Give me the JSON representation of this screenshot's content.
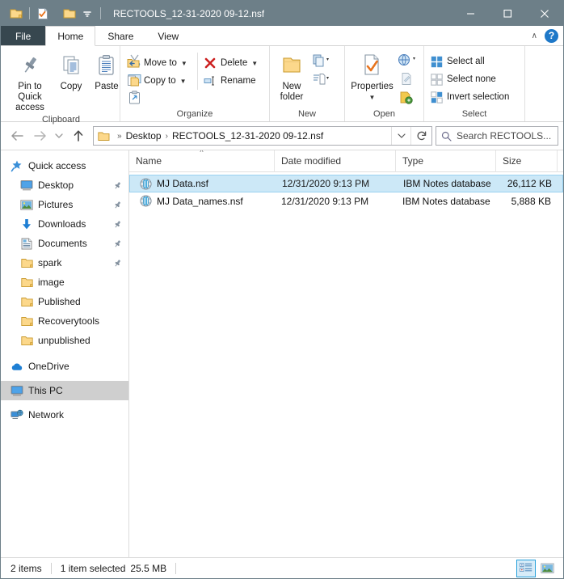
{
  "window": {
    "title": "RECTOOLS_12-31-2020 09-12.nsf",
    "titlebar_color": "#6d7f88",
    "quick_access": [
      {
        "name": "folder-icon",
        "label": "Restore/Folder"
      },
      {
        "name": "properties-icon",
        "label": "Properties"
      },
      {
        "name": "new-folder-icon",
        "label": "New folder"
      },
      {
        "name": "chevron-down-icon",
        "label": "Customize Quick Access Toolbar"
      }
    ],
    "controls": {
      "minimize": "—",
      "maximize": "☐",
      "close": "✕"
    }
  },
  "tabs": [
    {
      "label": "File",
      "active": false,
      "kind": "file"
    },
    {
      "label": "Home",
      "active": true,
      "kind": "normal"
    },
    {
      "label": "Share",
      "active": false,
      "kind": "normal"
    },
    {
      "label": "View",
      "active": false,
      "kind": "normal"
    }
  ],
  "tabbar_right": {
    "collapse_label": "∧",
    "help_label": "?"
  },
  "ribbon": {
    "groups": [
      {
        "label": "Clipboard",
        "big_buttons": [
          {
            "name": "pin-to-quick-access-button",
            "label": "Pin to Quick\naccess",
            "line1": "Pin to Quick",
            "line2": "access"
          },
          {
            "name": "copy-button",
            "label": "Copy",
            "line1": "Copy",
            "line2": ""
          },
          {
            "name": "paste-button",
            "label": "Paste",
            "line1": "Paste",
            "line2": ""
          }
        ],
        "small_icons": [
          {
            "name": "cut-icon",
            "label": "Cut"
          },
          {
            "name": "copy-path-icon",
            "label": "Copy path"
          },
          {
            "name": "paste-shortcut-icon",
            "label": "Paste shortcut"
          }
        ]
      },
      {
        "label": "Organize",
        "items": [
          {
            "name": "move-to-button",
            "label": "Move to",
            "caret": true
          },
          {
            "name": "copy-to-button",
            "label": "Copy to",
            "caret": true
          },
          {
            "name": "delete-button",
            "label": "Delete",
            "caret": true
          },
          {
            "name": "rename-button",
            "label": "Rename",
            "caret": false
          }
        ]
      },
      {
        "label": "New",
        "big_buttons": [
          {
            "name": "new-folder-button",
            "line1": "New",
            "line2": "folder"
          }
        ],
        "small_icons": [
          {
            "name": "new-item-icon",
            "label": "New item"
          },
          {
            "name": "easy-access-icon",
            "label": "Easy access"
          }
        ]
      },
      {
        "label": "Open",
        "big_buttons": [
          {
            "name": "properties-button",
            "line1": "Properties",
            "line2": ""
          }
        ],
        "small_icons": [
          {
            "name": "open-icon",
            "label": "Open"
          },
          {
            "name": "edit-icon",
            "label": "Edit"
          },
          {
            "name": "history-icon",
            "label": "History"
          }
        ]
      },
      {
        "label": "Select",
        "items": [
          {
            "name": "select-all-button",
            "label": "Select all"
          },
          {
            "name": "select-none-button",
            "label": "Select none"
          },
          {
            "name": "invert-selection-button",
            "label": "Invert selection"
          }
        ]
      }
    ]
  },
  "address": {
    "back_label": "←",
    "forward_label": "→",
    "recent_label": "∨",
    "up_label": "↑",
    "separator": "»",
    "crumbs": [
      "Desktop",
      "RECTOOLS_12-31-2020 09-12.nsf"
    ],
    "crumb_sep": "›",
    "dropdown_label": "∨",
    "refresh_label": "↻",
    "search_placeholder": "Search RECTOOLS..."
  },
  "navpane": {
    "items": [
      {
        "name": "sidebar-item-quick-access",
        "label": "Quick access",
        "icon": "star-pin-icon",
        "indent": 0,
        "pinned": false,
        "selected": false
      },
      {
        "name": "sidebar-item-desktop",
        "label": "Desktop",
        "icon": "desktop-icon",
        "indent": 1,
        "pinned": true,
        "selected": false
      },
      {
        "name": "sidebar-item-pictures",
        "label": "Pictures",
        "icon": "pictures-icon",
        "indent": 1,
        "pinned": true,
        "selected": false
      },
      {
        "name": "sidebar-item-downloads",
        "label": "Downloads",
        "icon": "downloads-icon",
        "indent": 1,
        "pinned": true,
        "selected": false
      },
      {
        "name": "sidebar-item-documents",
        "label": "Documents",
        "icon": "documents-icon",
        "indent": 1,
        "pinned": true,
        "selected": false
      },
      {
        "name": "sidebar-item-spark",
        "label": "spark",
        "icon": "folder-icon",
        "indent": 1,
        "pinned": true,
        "selected": false
      },
      {
        "name": "sidebar-item-image",
        "label": "image",
        "icon": "folder-icon",
        "indent": 1,
        "pinned": false,
        "selected": false
      },
      {
        "name": "sidebar-item-published",
        "label": "Published",
        "icon": "folder-icon",
        "indent": 1,
        "pinned": false,
        "selected": false
      },
      {
        "name": "sidebar-item-recoverytools",
        "label": "Recoverytools",
        "icon": "folder-icon",
        "indent": 1,
        "pinned": false,
        "selected": false
      },
      {
        "name": "sidebar-item-unpublished",
        "label": "unpublished",
        "icon": "folder-icon",
        "indent": 1,
        "pinned": false,
        "selected": false
      },
      {
        "name": "sidebar-item-onedrive",
        "label": "OneDrive",
        "icon": "cloud-icon",
        "indent": 0,
        "pinned": false,
        "selected": false
      },
      {
        "name": "sidebar-item-this-pc",
        "label": "This PC",
        "icon": "desktop-icon",
        "indent": 0,
        "pinned": false,
        "selected": true
      },
      {
        "name": "sidebar-item-network",
        "label": "Network",
        "icon": "network-icon",
        "indent": 0,
        "pinned": false,
        "selected": false
      }
    ]
  },
  "filelist": {
    "columns": [
      {
        "name": "column-name",
        "label": "Name",
        "sorted": true,
        "sort_dir": "asc"
      },
      {
        "name": "column-date-modified",
        "label": "Date modified",
        "sorted": false
      },
      {
        "name": "column-type",
        "label": "Type",
        "sorted": false
      },
      {
        "name": "column-size",
        "label": "Size",
        "sorted": false
      }
    ],
    "rows": [
      {
        "name": "MJ Data.nsf",
        "date": "12/31/2020 9:13 PM",
        "type": "IBM Notes database",
        "size": "26,112 KB",
        "icon": "notes-database-icon",
        "selected": true
      },
      {
        "name": "MJ Data_names.nsf",
        "date": "12/31/2020 9:13 PM",
        "type": "IBM Notes database",
        "size": "5,888 KB",
        "icon": "notes-database-icon",
        "selected": false
      }
    ]
  },
  "statusbar": {
    "item_count": "2 items",
    "selection": "1 item selected",
    "selection_size": "25.5 MB",
    "views": [
      {
        "name": "details-view-button",
        "label": "Details view",
        "active": true
      },
      {
        "name": "large-icons-view-button",
        "label": "Large icons view",
        "active": false
      }
    ]
  },
  "colors": {
    "titlebar": "#6d7f88",
    "selection": "#cce8f7",
    "selection_border": "#99d1f0",
    "accent": "#1e78c8",
    "file_tab": "#37474f"
  }
}
